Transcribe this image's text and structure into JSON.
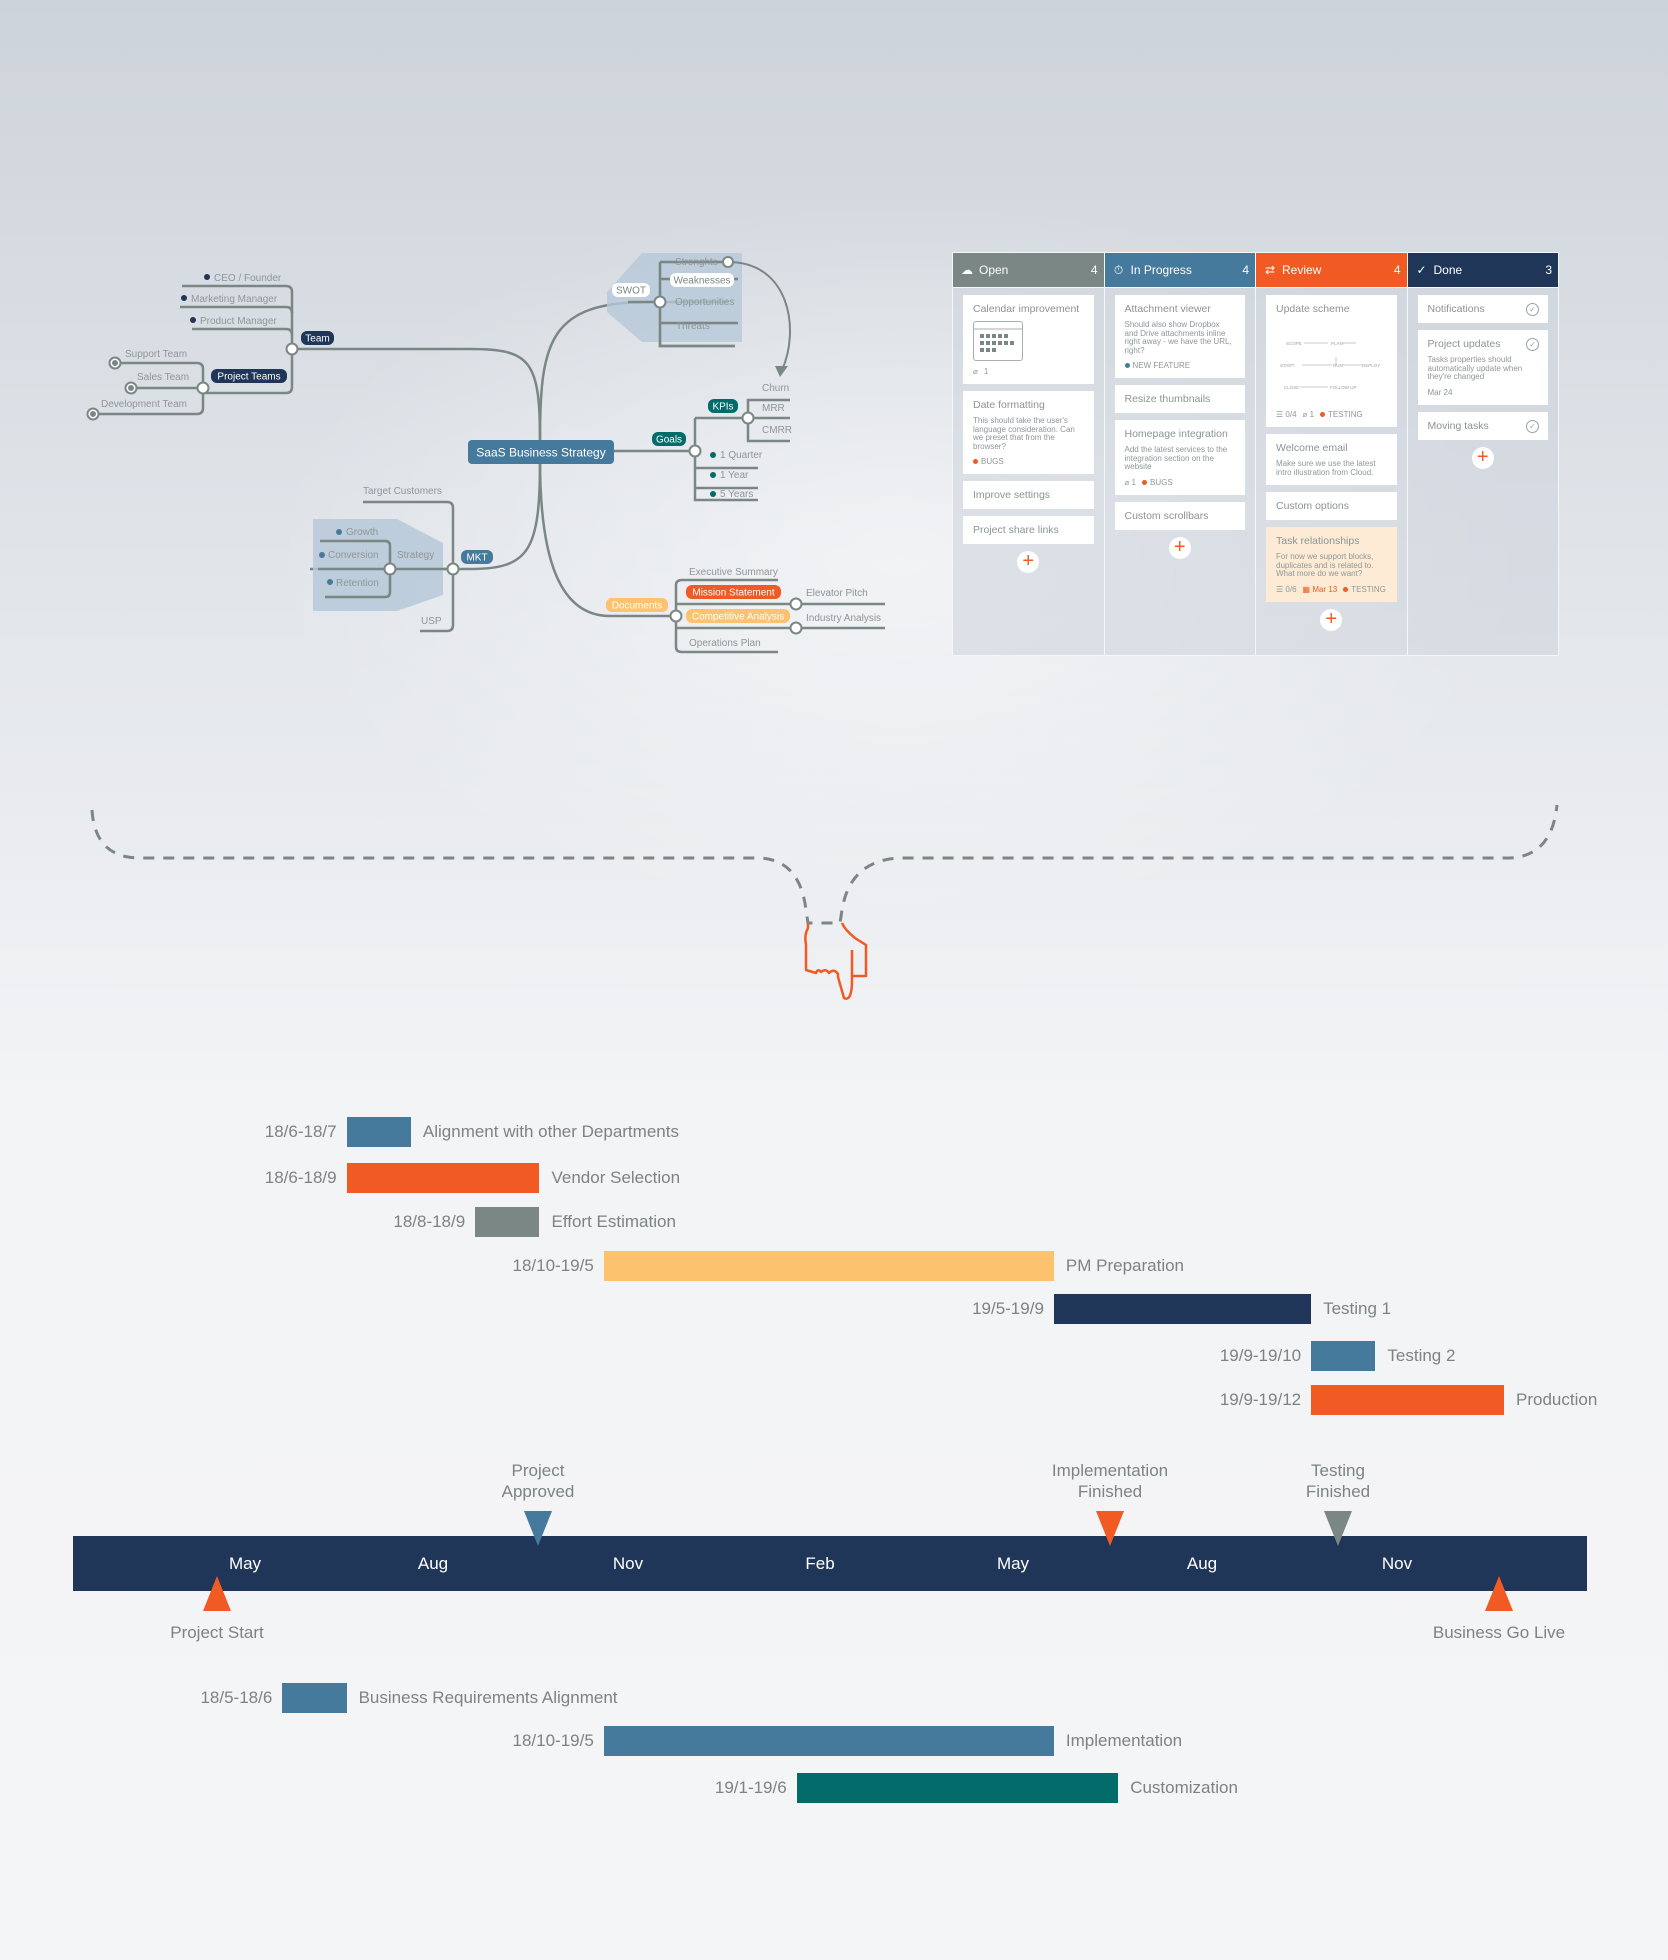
{
  "colors": {
    "navy": "#1f3658",
    "steel_blue": "#457a9c",
    "orange": "#f15a22",
    "gray": "#7a8784",
    "light_orange": "#fdc26e",
    "teal": "#036b69",
    "mind_line": "#7a8784",
    "mind_text": "#8e9697",
    "swot_fill": "#b7c8d8"
  },
  "mindmap": {
    "root": "SaaS Business Strategy",
    "team": {
      "label": "Team",
      "members": [
        "CEO / Founder",
        "Marketing Manager",
        "Product Manager"
      ],
      "project_teams": {
        "label": "Project Teams",
        "items": [
          "Support Team",
          "Sales Team",
          "Development Team"
        ]
      }
    },
    "swot": {
      "label": "SWOT",
      "items": [
        "Strenghts",
        "Weaknesses",
        "Opportunities",
        "Threats"
      ]
    },
    "goals": {
      "label": "Goals",
      "kpis": {
        "label": "KPIs",
        "items": [
          "Churn",
          "MRR",
          "CMRR"
        ]
      },
      "horizons": [
        "1 Quarter",
        "1 Year",
        "5 Years"
      ]
    },
    "mkt": {
      "label": "MKT",
      "items": [
        "Target Customers",
        "USP"
      ],
      "strategy": {
        "label": "Strategy",
        "items": [
          "Growth",
          "Conversion",
          "Retention"
        ]
      }
    },
    "documents": {
      "label": "Documents",
      "items": [
        "Executive Summary",
        "Mission Statement",
        "Competitive Analysis",
        "Operations Plan"
      ],
      "sub": [
        "Elevator Pitch",
        "Industry Analysis"
      ]
    }
  },
  "kanban": {
    "columns": [
      {
        "name": "Open",
        "count": "4",
        "icon": "cloud-icon",
        "color": "#7a8784",
        "cards": [
          {
            "title": "Calendar improvement",
            "attachments": "1"
          },
          {
            "title": "Date formatting",
            "desc": "This should take the user's language consideration. Can we preset that from the browser?",
            "tag": "BUGS"
          },
          {
            "title": "Improve settings"
          },
          {
            "title": "Project share links"
          }
        ]
      },
      {
        "name": "In Progress",
        "count": "4",
        "icon": "stopwatch-icon",
        "color": "#457a9c",
        "cards": [
          {
            "title": "Attachment viewer",
            "desc": "Should also show Dropbox and Drive attachments inline right away - we have the URL, right?",
            "tag": "NEW FEATURE"
          },
          {
            "title": "Resize thumbnails"
          },
          {
            "title": "Homepage integration",
            "desc": "Add the latest services to the integration section on the website",
            "attachments": "1",
            "tag": "BUGS"
          },
          {
            "title": "Custom scrollbars"
          }
        ]
      },
      {
        "name": "Review",
        "count": "4",
        "icon": "shuffle-icon",
        "color": "#f15a22",
        "cards": [
          {
            "title": "Update scheme",
            "checklist": "0/4",
            "attachments": "1",
            "tag": "TESTING",
            "scheme_labels": [
              "SCOPE",
              "PLAN",
              "START",
              "RUN",
              "DEPLOY",
              "CLOSE",
              "FOLLOW UP"
            ]
          },
          {
            "title": "Welcome email",
            "desc": "Make sure we use the latest intro illustration from Cloud."
          },
          {
            "title": "Custom options"
          },
          {
            "title": "Task relationships",
            "desc": "For now we support blocks, duplicates and is related to. What more do we want?",
            "checklist": "0/6",
            "due": "Mar 13",
            "tag": "TESTING"
          }
        ]
      },
      {
        "name": "Done",
        "count": "3",
        "icon": "check-circle-icon",
        "color": "#1f3658",
        "cards": [
          {
            "title": "Notifications"
          },
          {
            "title": "Project updates",
            "desc": "Tasks properties should automatically update when they're changed",
            "date": "Mar 24"
          },
          {
            "title": "Moving tasks"
          }
        ]
      }
    ]
  },
  "chart_data": {
    "type": "gantt",
    "title": "",
    "axis": {
      "start": "2018-04",
      "end": "2020-01",
      "ticks": [
        "May",
        "Aug",
        "Nov",
        "Feb",
        "May",
        "Aug",
        "Nov"
      ]
    },
    "tasks_above": [
      {
        "range": "18/6-18/7",
        "name": "Alignment with other Departments",
        "start": "2018-06",
        "end": "2018-07",
        "color": "#457a9c"
      },
      {
        "range": "18/6-18/9",
        "name": "Vendor Selection",
        "start": "2018-06",
        "end": "2018-09",
        "color": "#f15a22"
      },
      {
        "range": "18/8-18/9",
        "name": "Effort Estimation",
        "start": "2018-08",
        "end": "2018-09",
        "color": "#7a8784"
      },
      {
        "range": "18/10-19/5",
        "name": "PM Preparation",
        "start": "2018-10",
        "end": "2019-05",
        "color": "#fdc26e"
      },
      {
        "range": "19/5-19/9",
        "name": "Testing 1",
        "start": "2019-05",
        "end": "2019-09",
        "color": "#1f3658"
      },
      {
        "range": "19/9-19/10",
        "name": "Testing 2",
        "start": "2019-09",
        "end": "2019-10",
        "color": "#457a9c"
      },
      {
        "range": "19/9-19/12",
        "name": "Production",
        "start": "2019-09",
        "end": "2019-12",
        "color": "#f15a22"
      }
    ],
    "milestones": [
      {
        "label": "Project Start",
        "date": "2018-05",
        "side": "below",
        "color": "#f15a22"
      },
      {
        "label": "Project Approved",
        "date": "2018-10",
        "side": "above",
        "color": "#457a9c"
      },
      {
        "label": "Implementation Finished",
        "date": "2019-06",
        "side": "above",
        "color": "#f15a22"
      },
      {
        "label": "Testing Finished",
        "date": "2019-10",
        "side": "above",
        "color": "#7a8784"
      },
      {
        "label": "Business Go Live",
        "date": "2019-12",
        "side": "below",
        "color": "#f15a22"
      }
    ],
    "tasks_below": [
      {
        "range": "18/5-18/6",
        "name": "Business Requirements Alignment",
        "start": "2018-05",
        "end": "2018-06",
        "color": "#457a9c"
      },
      {
        "range": "18/10-19/5",
        "name": "Implementation",
        "start": "2018-10",
        "end": "2019-05",
        "color": "#457a9c"
      },
      {
        "range": "19/1-19/6",
        "name": "Customization",
        "start": "2019-01",
        "end": "2019-06",
        "color": "#036b69"
      }
    ]
  }
}
